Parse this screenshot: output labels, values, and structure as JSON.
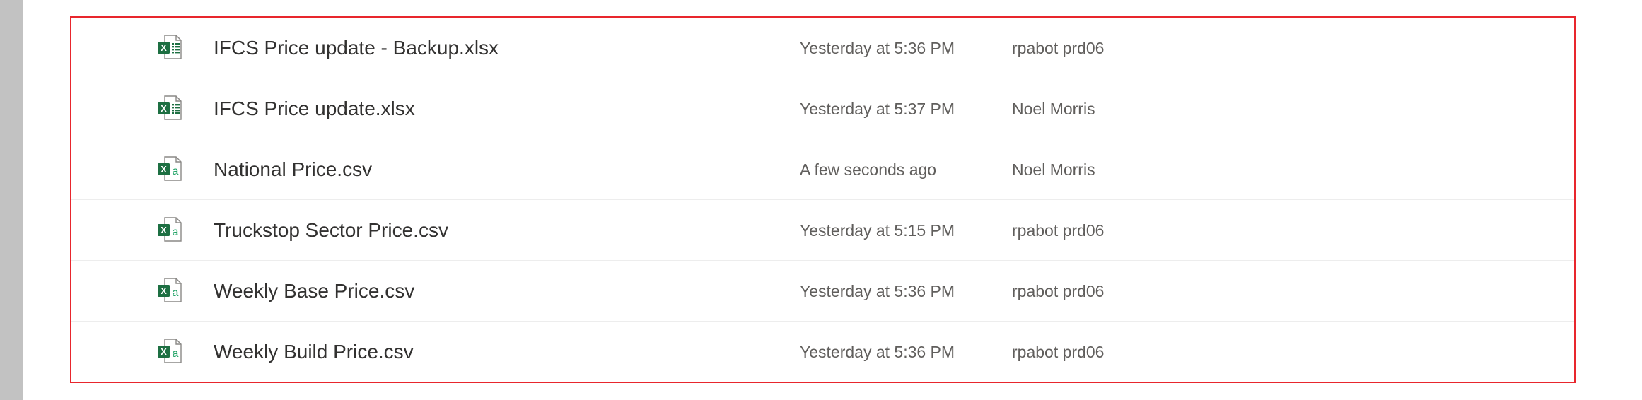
{
  "files": [
    {
      "name": "IFCS Price update - Backup.xlsx",
      "modified": "Yesterday at 5:36 PM",
      "modified_by": "rpabot prd06",
      "icon": "excel-xlsx-icon",
      "icon_letter": "x"
    },
    {
      "name": "IFCS Price update.xlsx",
      "modified": "Yesterday at 5:37 PM",
      "modified_by": "Noel Morris",
      "icon": "excel-xlsx-icon",
      "icon_letter": "x"
    },
    {
      "name": "National Price.csv",
      "modified": "A few seconds ago",
      "modified_by": "Noel Morris",
      "icon": "excel-csv-icon",
      "icon_letter": "a"
    },
    {
      "name": "Truckstop Sector Price.csv",
      "modified": "Yesterday at 5:15 PM",
      "modified_by": "rpabot prd06",
      "icon": "excel-csv-icon",
      "icon_letter": "a"
    },
    {
      "name": "Weekly Base Price.csv",
      "modified": "Yesterday at 5:36 PM",
      "modified_by": "rpabot prd06",
      "icon": "excel-csv-icon",
      "icon_letter": "a"
    },
    {
      "name": "Weekly Build Price.csv",
      "modified": "Yesterday at 5:36 PM",
      "modified_by": "rpabot prd06",
      "icon": "excel-csv-icon",
      "icon_letter": "a"
    }
  ],
  "colors": {
    "excel_green": "#1d6f42",
    "excel_green_light": "#21a366",
    "highlight_border": "#e8262d",
    "scrollbar": "#c2c2c2"
  }
}
